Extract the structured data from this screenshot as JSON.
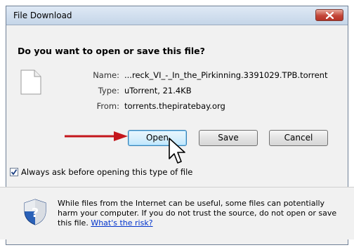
{
  "window": {
    "title": "File Download"
  },
  "dialog": {
    "heading": "Do you want to open or save this file?",
    "fields": [
      {
        "label": "Name:",
        "value": "...reck_VI_-_In_the_Pirkinning.3391029.TPB.torrent"
      },
      {
        "label": "Type:",
        "value": "uTorrent, 21.4KB"
      },
      {
        "label": "From:",
        "value": "torrents.thepiratebay.org"
      }
    ],
    "buttons": {
      "open": "Open",
      "save": "Save",
      "cancel": "Cancel"
    },
    "checkbox": {
      "label": "Always ask before opening this type of file",
      "checked": true
    },
    "warning": {
      "text": "While files from the Internet can be useful, some files can potentially harm your computer. If you do not trust the source, do not open or save this file.",
      "link": "What's the risk?"
    }
  },
  "icons": {
    "close": "close-icon",
    "file": "file-icon",
    "arrow": "red-arrow-icon",
    "cursor": "mouse-cursor-icon",
    "check": "checkmark-icon",
    "shield": "shield-icon"
  },
  "colors": {
    "arrow": "#c4161c",
    "link": "#0033cc",
    "close": "#c4473a",
    "shield": "#2a61b8"
  }
}
